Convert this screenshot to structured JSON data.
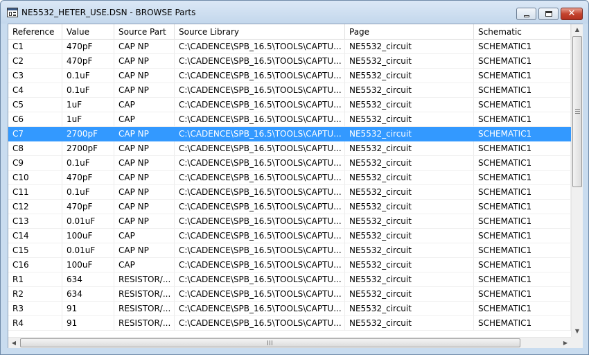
{
  "window": {
    "title": "NE5532_HETER_USE.DSN - BROWSE Parts",
    "icon": "schematic-app-icon",
    "controls": {
      "minimize_icon": "minimize-icon",
      "maximize_icon": "maximize-icon",
      "close_icon": "close-icon",
      "close_glyph": "✕"
    }
  },
  "table": {
    "columns": [
      "Reference",
      "Value",
      "Source Part",
      "Source Library",
      "Page",
      "Schematic"
    ],
    "selected_row": 6,
    "selection_color": "#3399ff",
    "rows": [
      [
        "C1",
        "470pF",
        "CAP NP",
        "C:\\CADENCE\\SPB_16.5\\TOOLS\\CAPTU...",
        "NE5532_circuit",
        "SCHEMATIC1"
      ],
      [
        "C2",
        "470pF",
        "CAP NP",
        "C:\\CADENCE\\SPB_16.5\\TOOLS\\CAPTU...",
        "NE5532_circuit",
        "SCHEMATIC1"
      ],
      [
        "C3",
        "0.1uF",
        "CAP NP",
        "C:\\CADENCE\\SPB_16.5\\TOOLS\\CAPTU...",
        "NE5532_circuit",
        "SCHEMATIC1"
      ],
      [
        "C4",
        "0.1uF",
        "CAP NP",
        "C:\\CADENCE\\SPB_16.5\\TOOLS\\CAPTU...",
        "NE5532_circuit",
        "SCHEMATIC1"
      ],
      [
        "C5",
        "1uF",
        "CAP",
        "C:\\CADENCE\\SPB_16.5\\TOOLS\\CAPTU...",
        "NE5532_circuit",
        "SCHEMATIC1"
      ],
      [
        "C6",
        "1uF",
        "CAP",
        "C:\\CADENCE\\SPB_16.5\\TOOLS\\CAPTU...",
        "NE5532_circuit",
        "SCHEMATIC1"
      ],
      [
        "C7",
        "2700pF",
        "CAP NP",
        "C:\\CADENCE\\SPB_16.5\\TOOLS\\CAPTU...",
        "NE5532_circuit",
        "SCHEMATIC1"
      ],
      [
        "C8",
        "2700pF",
        "CAP NP",
        "C:\\CADENCE\\SPB_16.5\\TOOLS\\CAPTU...",
        "NE5532_circuit",
        "SCHEMATIC1"
      ],
      [
        "C9",
        "0.1uF",
        "CAP NP",
        "C:\\CADENCE\\SPB_16.5\\TOOLS\\CAPTU...",
        "NE5532_circuit",
        "SCHEMATIC1"
      ],
      [
        "C10",
        "470pF",
        "CAP NP",
        "C:\\CADENCE\\SPB_16.5\\TOOLS\\CAPTU...",
        "NE5532_circuit",
        "SCHEMATIC1"
      ],
      [
        "C11",
        "0.1uF",
        "CAP NP",
        "C:\\CADENCE\\SPB_16.5\\TOOLS\\CAPTU...",
        "NE5532_circuit",
        "SCHEMATIC1"
      ],
      [
        "C12",
        "470pF",
        "CAP NP",
        "C:\\CADENCE\\SPB_16.5\\TOOLS\\CAPTU...",
        "NE5532_circuit",
        "SCHEMATIC1"
      ],
      [
        "C13",
        "0.01uF",
        "CAP NP",
        "C:\\CADENCE\\SPB_16.5\\TOOLS\\CAPTU...",
        "NE5532_circuit",
        "SCHEMATIC1"
      ],
      [
        "C14",
        "100uF",
        "CAP",
        "C:\\CADENCE\\SPB_16.5\\TOOLS\\CAPTU...",
        "NE5532_circuit",
        "SCHEMATIC1"
      ],
      [
        "C15",
        "0.01uF",
        "CAP NP",
        "C:\\CADENCE\\SPB_16.5\\TOOLS\\CAPTU...",
        "NE5532_circuit",
        "SCHEMATIC1"
      ],
      [
        "C16",
        "100uF",
        "CAP",
        "C:\\CADENCE\\SPB_16.5\\TOOLS\\CAPTU...",
        "NE5532_circuit",
        "SCHEMATIC1"
      ],
      [
        "R1",
        "634",
        "RESISTOR/...",
        "C:\\CADENCE\\SPB_16.5\\TOOLS\\CAPTU...",
        "NE5532_circuit",
        "SCHEMATIC1"
      ],
      [
        "R2",
        "634",
        "RESISTOR/...",
        "C:\\CADENCE\\SPB_16.5\\TOOLS\\CAPTU...",
        "NE5532_circuit",
        "SCHEMATIC1"
      ],
      [
        "R3",
        "91",
        "RESISTOR/...",
        "C:\\CADENCE\\SPB_16.5\\TOOLS\\CAPTU...",
        "NE5532_circuit",
        "SCHEMATIC1"
      ],
      [
        "R4",
        "91",
        "RESISTOR/...",
        "C:\\CADENCE\\SPB_16.5\\TOOLS\\CAPTU...",
        "NE5532_circuit",
        "SCHEMATIC1"
      ]
    ]
  },
  "scrollbars": {
    "vertical": {
      "up_icon": "scroll-up-arrow-icon",
      "down_icon": "scroll-down-arrow-icon",
      "up_glyph": "▲",
      "down_glyph": "▼"
    },
    "horizontal": {
      "left_icon": "scroll-left-arrow-icon",
      "right_icon": "scroll-right-arrow-icon",
      "left_glyph": "◀",
      "right_glyph": "▶"
    }
  }
}
